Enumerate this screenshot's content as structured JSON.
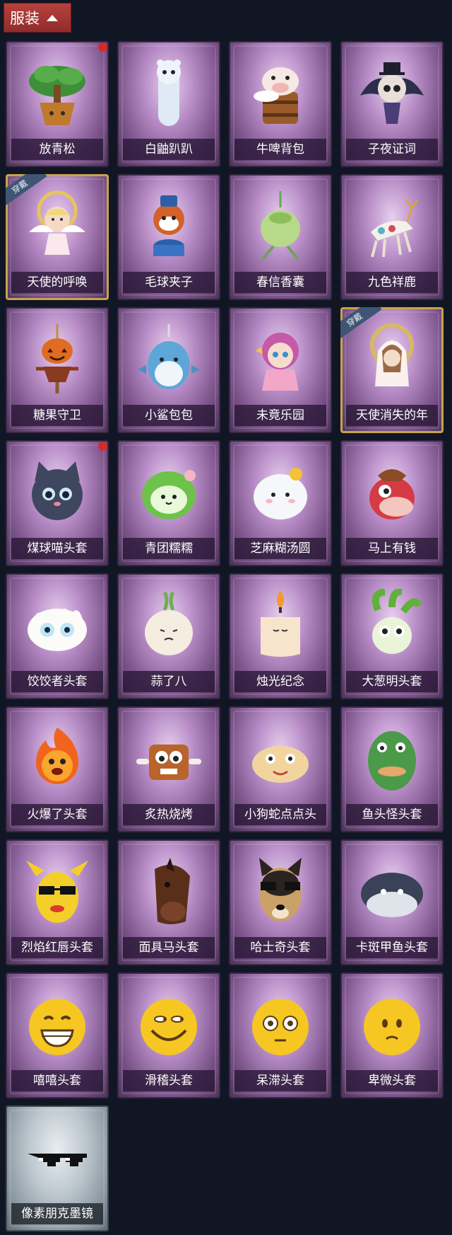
{
  "header": {
    "tab_label": "服装"
  },
  "items": [
    {
      "name": "放青松",
      "icon": "bonsai-pine-icon",
      "dot": true,
      "worn": false,
      "style": "purple"
    },
    {
      "name": "白鼬趴趴",
      "icon": "white-ferret-icon",
      "dot": false,
      "worn": false,
      "style": "purple"
    },
    {
      "name": "牛啤背包",
      "icon": "cow-beer-backpack-icon",
      "dot": false,
      "worn": false,
      "style": "purple"
    },
    {
      "name": "子夜证词",
      "icon": "midnight-owl-icon",
      "dot": false,
      "worn": false,
      "style": "purple"
    },
    {
      "name": "天使的呼唤",
      "icon": "angel-call-icon",
      "dot": false,
      "worn": true,
      "style": "purple"
    },
    {
      "name": "毛球夹子",
      "icon": "red-panda-drummer-icon",
      "dot": false,
      "worn": false,
      "style": "purple"
    },
    {
      "name": "春信香囊",
      "icon": "spring-sachet-icon",
      "dot": false,
      "worn": false,
      "style": "purple"
    },
    {
      "name": "九色祥鹿",
      "icon": "nine-color-deer-icon",
      "dot": false,
      "worn": false,
      "style": "purple"
    },
    {
      "name": "糖果守卫",
      "icon": "pumpkin-scarecrow-icon",
      "dot": false,
      "worn": false,
      "style": "purple"
    },
    {
      "name": "小鲨包包",
      "icon": "shark-bag-icon",
      "dot": false,
      "worn": false,
      "style": "purple"
    },
    {
      "name": "未竟乐园",
      "icon": "pink-hair-girl-icon",
      "dot": false,
      "worn": false,
      "style": "purple"
    },
    {
      "name": "天使消失的年",
      "icon": "angel-veil-icon",
      "dot": false,
      "worn": true,
      "style": "purple"
    },
    {
      "name": "煤球喵头套",
      "icon": "black-cat-head-icon",
      "dot": true,
      "worn": false,
      "style": "purple"
    },
    {
      "name": "青团糯糯",
      "icon": "green-rice-ball-icon",
      "dot": false,
      "worn": false,
      "style": "purple"
    },
    {
      "name": "芝麻糊汤圆",
      "icon": "sesame-dumpling-icon",
      "dot": false,
      "worn": false,
      "style": "purple"
    },
    {
      "name": "马上有钱",
      "icon": "red-horse-head-icon",
      "dot": false,
      "worn": false,
      "style": "purple"
    },
    {
      "name": "饺饺者头套",
      "icon": "dumpling-head-icon",
      "dot": false,
      "worn": false,
      "style": "purple"
    },
    {
      "name": "蒜了八",
      "icon": "garlic-head-icon",
      "dot": false,
      "worn": false,
      "style": "purple"
    },
    {
      "name": "烛光纪念",
      "icon": "candle-head-icon",
      "dot": false,
      "worn": false,
      "style": "purple"
    },
    {
      "name": "大葱明头套",
      "icon": "scallion-head-icon",
      "dot": false,
      "worn": false,
      "style": "purple"
    },
    {
      "name": "火爆了头套",
      "icon": "fire-head-icon",
      "dot": false,
      "worn": false,
      "style": "purple"
    },
    {
      "name": "炙热烧烤",
      "icon": "bbq-meat-head-icon",
      "dot": false,
      "worn": false,
      "style": "purple"
    },
    {
      "name": "小狗蛇点点头",
      "icon": "dog-snake-head-icon",
      "dot": false,
      "worn": false,
      "style": "purple"
    },
    {
      "name": "鱼头怪头套",
      "icon": "fish-monster-head-icon",
      "dot": false,
      "worn": false,
      "style": "purple"
    },
    {
      "name": "烈焰红唇头套",
      "icon": "yellow-mouse-sunglasses-icon",
      "dot": false,
      "worn": false,
      "style": "purple"
    },
    {
      "name": "面具马头套",
      "icon": "horse-mask-icon",
      "dot": false,
      "worn": false,
      "style": "purple"
    },
    {
      "name": "哈士奇头套",
      "icon": "husky-sunglasses-icon",
      "dot": false,
      "worn": false,
      "style": "purple"
    },
    {
      "name": "卡斑甲鱼头套",
      "icon": "turtle-head-icon",
      "dot": false,
      "worn": false,
      "style": "purple"
    },
    {
      "name": "嘻嘻头套",
      "icon": "grin-emoji-head-icon",
      "dot": false,
      "worn": false,
      "style": "purple"
    },
    {
      "name": "滑稽头套",
      "icon": "smirk-emoji-head-icon",
      "dot": false,
      "worn": false,
      "style": "purple"
    },
    {
      "name": "呆滞头套",
      "icon": "dazed-emoji-head-icon",
      "dot": false,
      "worn": false,
      "style": "purple"
    },
    {
      "name": "卑微头套",
      "icon": "humble-emoji-head-icon",
      "dot": false,
      "worn": false,
      "style": "purple"
    },
    {
      "name": "像素朋克墨镜",
      "icon": "pixel-sunglasses-icon",
      "dot": false,
      "worn": false,
      "style": "gray"
    }
  ],
  "worn_badge": "穿戴"
}
